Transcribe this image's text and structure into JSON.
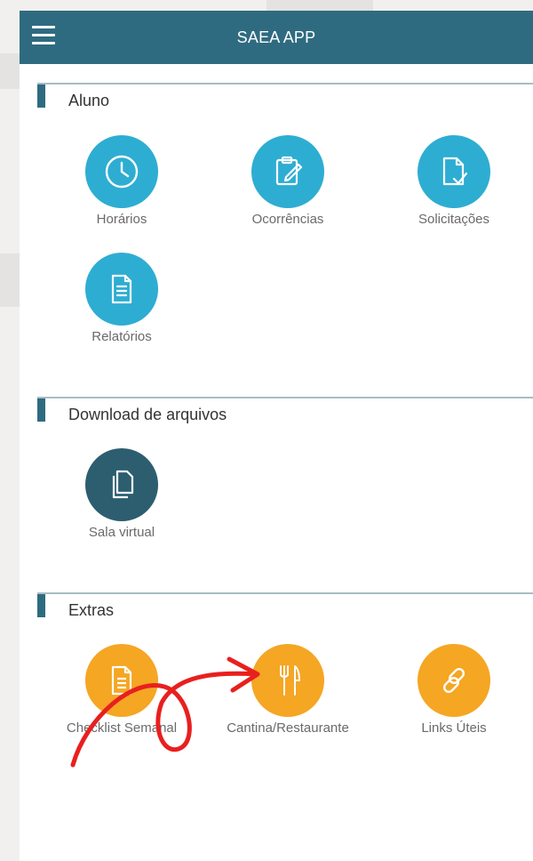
{
  "header": {
    "title": "SAEA APP",
    "menu_icon": "hamburger-menu-icon"
  },
  "sections": [
    {
      "title": "Aluno",
      "items": [
        {
          "label": "Horários",
          "icon": "clock-icon",
          "color": "#2eadd2"
        },
        {
          "label": "Ocorrências",
          "icon": "clipboard-edit-icon",
          "color": "#2eadd2"
        },
        {
          "label": "Solicitações",
          "icon": "document-check-icon",
          "color": "#2eadd2"
        },
        {
          "label": "Relatórios",
          "icon": "document-lines-icon",
          "color": "#2eadd2"
        }
      ]
    },
    {
      "title": "Download de arquivos",
      "items": [
        {
          "label": "Sala virtual",
          "icon": "files-icon",
          "color": "#2c5e70"
        }
      ]
    },
    {
      "title": "Extras",
      "items": [
        {
          "label": "Checklist Semanal",
          "icon": "checklist-document-icon",
          "color": "#f5a623"
        },
        {
          "label": "Cantina/Restaurante",
          "icon": "fork-knife-icon",
          "color": "#f5a623"
        },
        {
          "label": "Links Úteis",
          "icon": "link-icon",
          "color": "#f5a623"
        }
      ]
    }
  ],
  "colors": {
    "appbar": "#2f6b80",
    "annotation": "#e8201e"
  },
  "annotation": {
    "type": "hand-drawn-arrow",
    "from": "Checklist Semanal",
    "to": "Cantina/Restaurante"
  }
}
